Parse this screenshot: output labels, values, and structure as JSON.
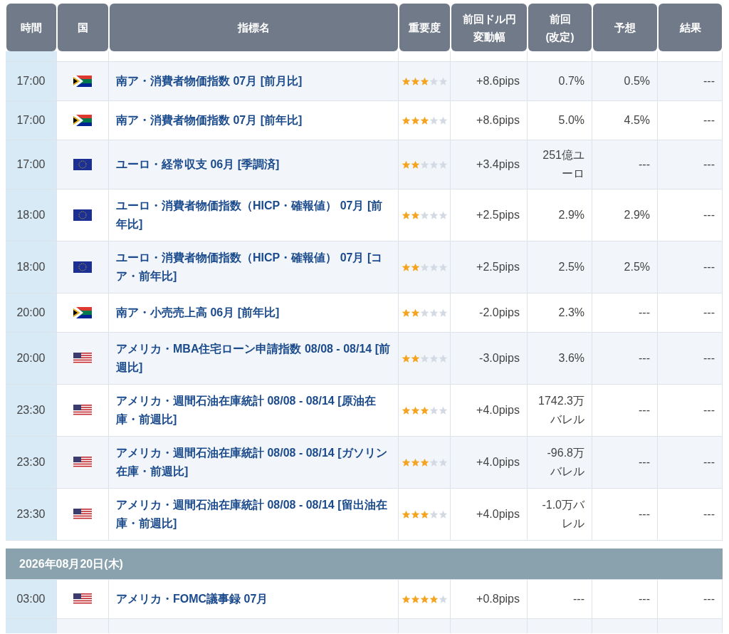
{
  "header": [
    {
      "lines": [
        "時間"
      ]
    },
    {
      "lines": [
        "国"
      ]
    },
    {
      "lines": [
        "指標名"
      ]
    },
    {
      "lines": [
        "重要度"
      ]
    },
    {
      "lines": [
        "前回ドル円",
        "変動幅"
      ]
    },
    {
      "lines": [
        "前回",
        "(改定)"
      ]
    },
    {
      "lines": [
        "予想"
      ]
    },
    {
      "lines": [
        "結果"
      ]
    }
  ],
  "days": [
    {
      "rows": [
        {
          "time": "17:00",
          "kind": "za",
          "name": "南ア・消費者物価指数 07月 [前月比]",
          "stars": 3,
          "change": "+8.6pips",
          "previous": "0.7%",
          "forecast": "0.5%",
          "result": "---"
        },
        {
          "time": "17:00",
          "kind": "za",
          "name": "南ア・消費者物価指数 07月 [前年比]",
          "stars": 3,
          "change": "+8.6pips",
          "previous": "5.0%",
          "forecast": "4.5%",
          "result": "---"
        },
        {
          "time": "17:00",
          "kind": "eu",
          "name": "ユーロ・経常収支 06月 [季調済]",
          "stars": 2,
          "change": "+3.4pips",
          "previous": "251億ユーロ",
          "forecast": "---",
          "result": "---"
        },
        {
          "time": "18:00",
          "kind": "eu",
          "name": "ユーロ・消費者物価指数（HICP・確報値） 07月 [前年比]",
          "stars": 2,
          "change": "+2.5pips",
          "previous": "2.9%",
          "forecast": "2.9%",
          "result": "---"
        },
        {
          "time": "18:00",
          "kind": "eu",
          "name": "ユーロ・消費者物価指数（HICP・確報値） 07月 [コア・前年比]",
          "stars": 2,
          "change": "+2.5pips",
          "previous": "2.5%",
          "forecast": "2.5%",
          "result": "---"
        },
        {
          "time": "20:00",
          "kind": "za",
          "name": "南ア・小売売上高 06月 [前年比]",
          "stars": 2,
          "change": "-2.0pips",
          "previous": "2.3%",
          "forecast": "---",
          "result": "---"
        },
        {
          "time": "20:00",
          "kind": "us",
          "name": "アメリカ・MBA住宅ローン申請指数 08/08 - 08/14 [前週比]",
          "stars": 2,
          "change": "-3.0pips",
          "previous": "3.6%",
          "forecast": "---",
          "result": "---"
        },
        {
          "time": "23:30",
          "kind": "us",
          "name": "アメリカ・週間石油在庫統計 08/08 - 08/14 [原油在庫・前週比]",
          "stars": 3,
          "change": "+4.0pips",
          "previous": "1742.3万バレル",
          "forecast": "---",
          "result": "---"
        },
        {
          "time": "23:30",
          "kind": "us",
          "name": "アメリカ・週間石油在庫統計 08/08 - 08/14 [ガソリン在庫・前週比]",
          "stars": 3,
          "change": "+4.0pips",
          "previous": "-96.8万バレル",
          "forecast": "---",
          "result": "---"
        },
        {
          "time": "23:30",
          "kind": "us",
          "name": "アメリカ・週間石油在庫統計 08/08 - 08/14 [留出油在庫・前週比]",
          "stars": 3,
          "change": "+4.0pips",
          "previous": "-1.0万バレル",
          "forecast": "---",
          "result": "---"
        }
      ]
    },
    {
      "date": "2026年08月20日(木)",
      "rows": [
        {
          "time": "03:00",
          "kind": "us",
          "name": "アメリカ・FOMC議事録 07月",
          "stars": 4,
          "change": "+0.8pips",
          "previous": "---",
          "forecast": "---",
          "result": "---"
        }
      ]
    }
  ]
}
